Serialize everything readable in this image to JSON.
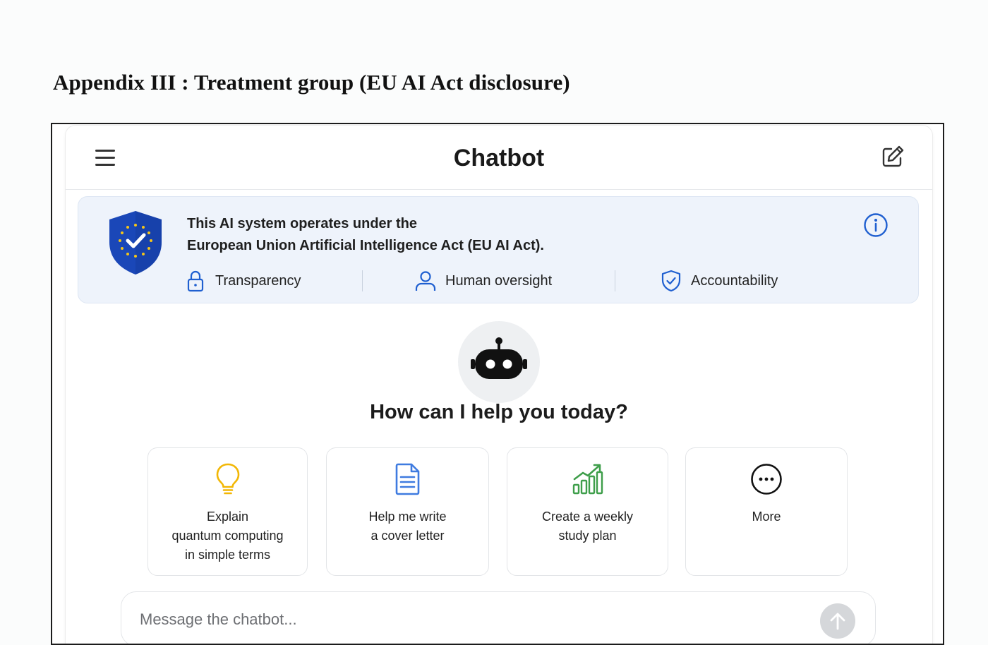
{
  "document": {
    "heading": "Appendix III : Treatment group (EU AI Act disclosure)"
  },
  "header": {
    "title": "Chatbot",
    "menu_icon": "hamburger-menu-icon",
    "edit_icon": "new-chat-edit-icon"
  },
  "disclosure": {
    "line1": "This AI system operates under the",
    "line2": "European Union Artificial Intelligence Act (EU AI Act).",
    "badge_icon": "eu-shield-check-icon",
    "info_icon": "info-icon",
    "principles": [
      {
        "label": "Transparency",
        "icon": "lock-icon"
      },
      {
        "label": "Human oversight",
        "icon": "person-icon"
      },
      {
        "label": "Accountability",
        "icon": "shield-check-icon"
      }
    ]
  },
  "main": {
    "avatar_icon": "robot-icon",
    "greeting": "How can I help you today?",
    "suggestions": [
      {
        "lines": [
          "Explain",
          "quantum computing",
          "in simple terms"
        ],
        "icon": "lightbulb-icon"
      },
      {
        "lines": [
          "Help me write",
          "a cover letter"
        ],
        "icon": "document-icon"
      },
      {
        "lines": [
          "Create a weekly",
          "study plan"
        ],
        "icon": "growth-chart-icon"
      },
      {
        "lines": [
          "More"
        ],
        "icon": "more-dots-icon"
      }
    ]
  },
  "composer": {
    "placeholder": "Message the chatbot...",
    "send_icon": "send-arrow-icon"
  },
  "colors": {
    "accent_blue": "#1f5fd0",
    "eu_blue": "#1a47b8",
    "eu_star": "#f5c518",
    "banner_bg": "#eef3fb",
    "bulb_yellow": "#f2b705",
    "doc_blue": "#3f7be0",
    "chart_green": "#3e9e4a"
  }
}
